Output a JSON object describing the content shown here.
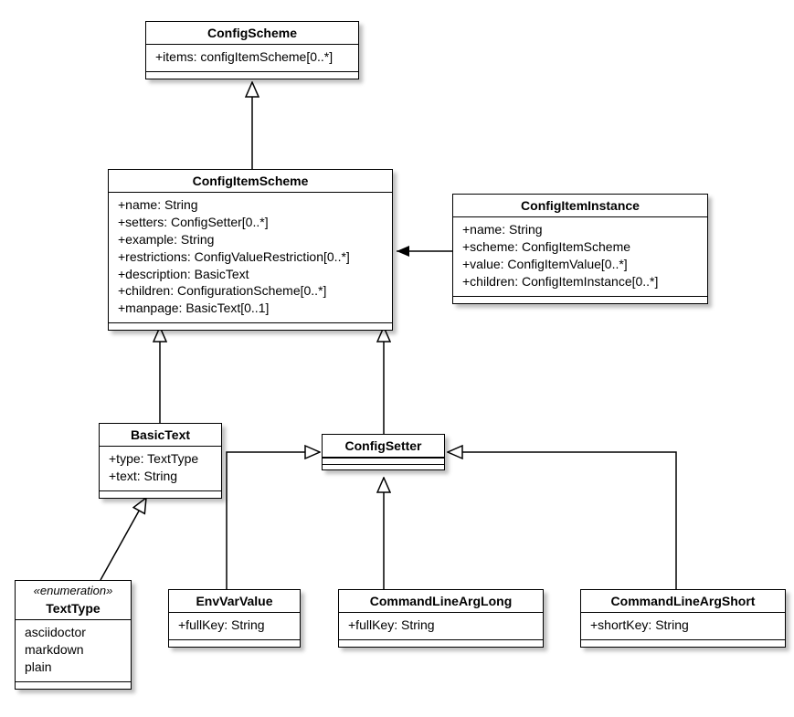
{
  "classes": {
    "ConfigScheme": {
      "title": "ConfigScheme",
      "attrs": [
        "+items: configItemScheme[0..*]"
      ]
    },
    "ConfigItemScheme": {
      "title": "ConfigItemScheme",
      "attrs": [
        "+name: String",
        "+setters: ConfigSetter[0..*]",
        "+example: String",
        "+restrictions: ConfigValueRestriction[0..*]",
        "+description: BasicText",
        "+children: ConfigurationScheme[0..*]",
        "+manpage: BasicText[0..1]"
      ]
    },
    "ConfigItemInstance": {
      "title": "ConfigItemInstance",
      "attrs": [
        "+name: String",
        "+scheme: ConfigItemScheme",
        "+value: ConfigItemValue[0..*]",
        "+children: ConfigItemInstance[0..*]"
      ]
    },
    "BasicText": {
      "title": "BasicText",
      "attrs": [
        "+type: TextType",
        "+text: String"
      ]
    },
    "ConfigSetter": {
      "title": "ConfigSetter"
    },
    "TextType": {
      "stereotype": "«enumeration»",
      "title": "TextType",
      "attrs": [
        "asciidoctor",
        "markdown",
        "plain"
      ]
    },
    "EnvVarValue": {
      "title": "EnvVarValue",
      "attrs": [
        "+fullKey: String"
      ]
    },
    "CommandLineArgLong": {
      "title": "CommandLineArgLong",
      "attrs": [
        "+fullKey: String"
      ]
    },
    "CommandLineArgShort": {
      "title": "CommandLineArgShort",
      "attrs": [
        "+shortKey: String"
      ]
    }
  }
}
